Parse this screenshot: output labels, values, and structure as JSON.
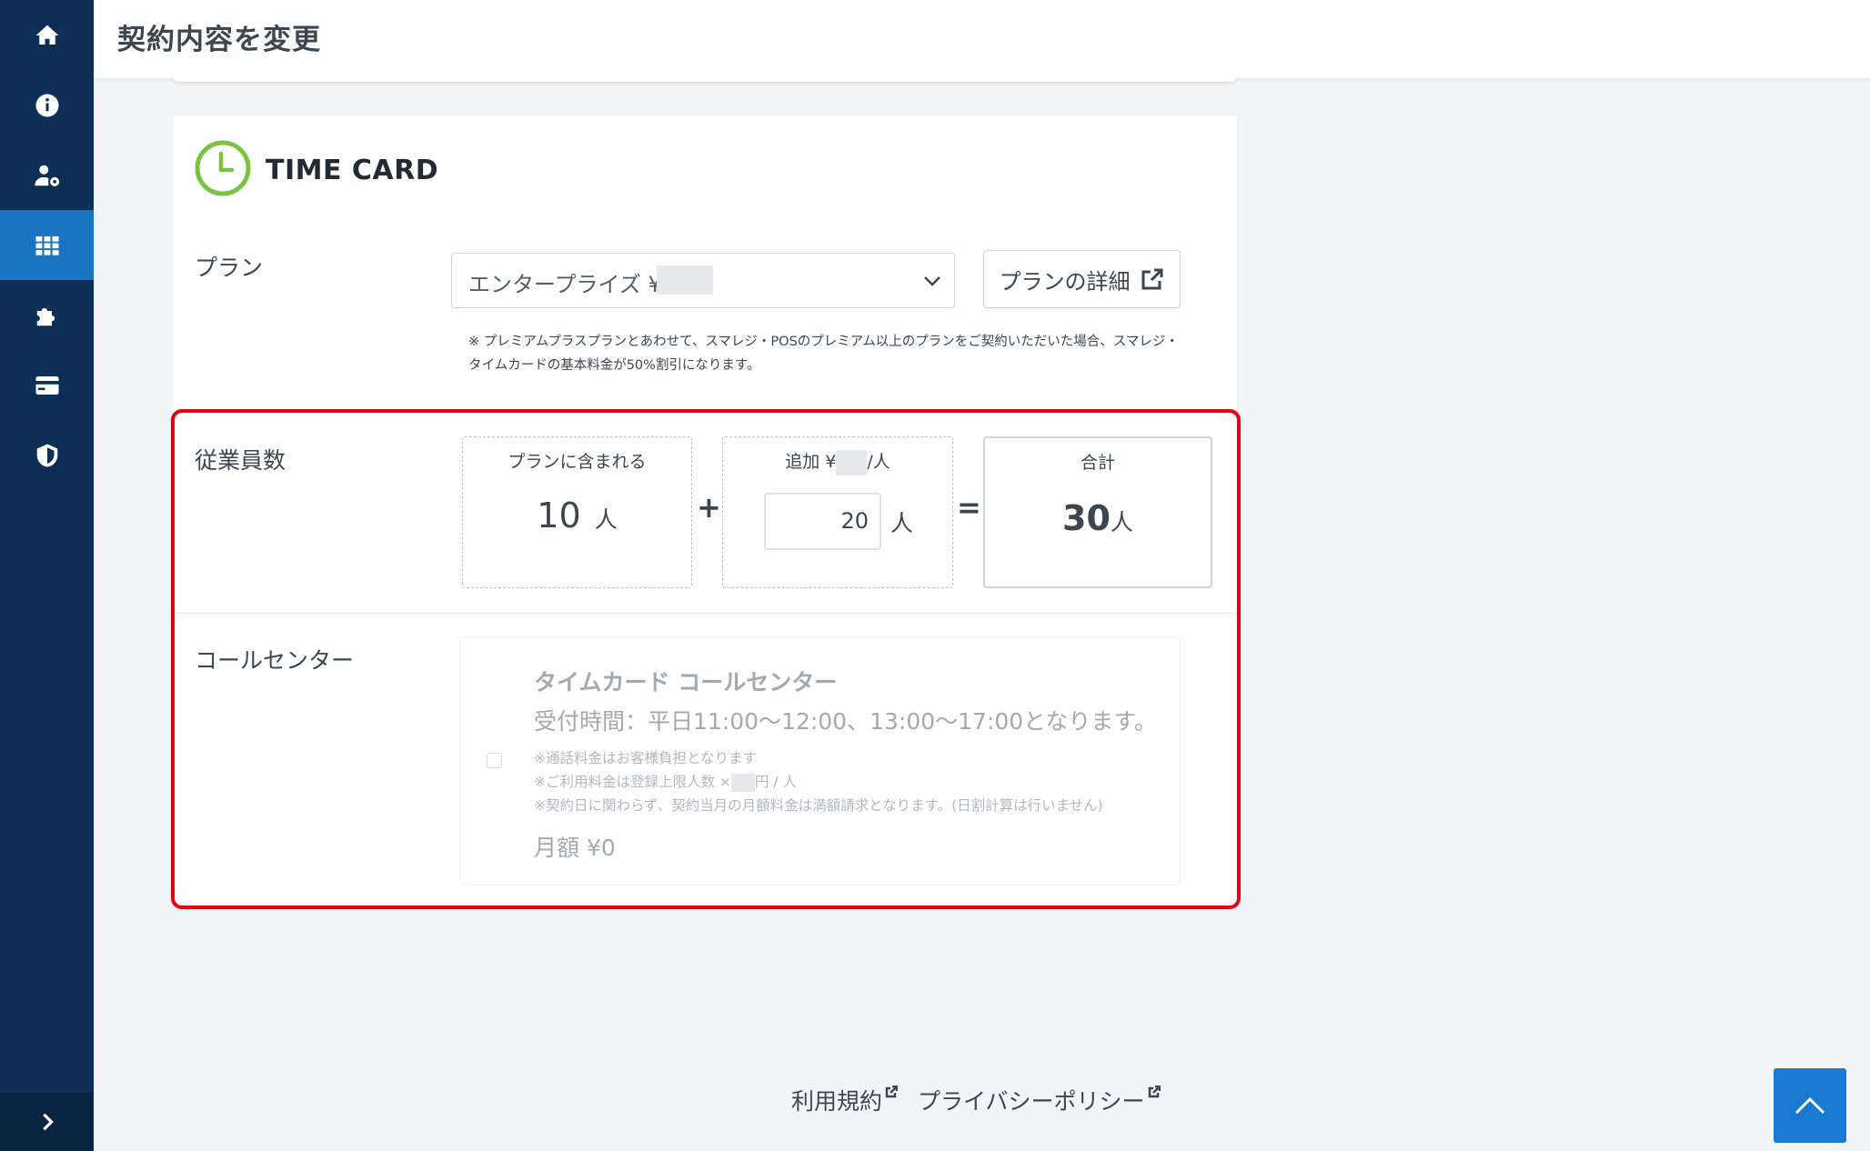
{
  "header": {
    "title": "契約内容を変更"
  },
  "sidebar": {
    "items": [
      {
        "icon": "home-icon",
        "active": false
      },
      {
        "icon": "info-icon",
        "active": false
      },
      {
        "icon": "user-settings-icon",
        "active": false
      },
      {
        "icon": "apps-grid-icon",
        "active": true
      },
      {
        "icon": "puzzle-icon",
        "active": false
      },
      {
        "icon": "credit-card-icon",
        "active": false
      },
      {
        "icon": "shield-icon",
        "active": false
      }
    ],
    "expand_icon": "chevron-right-icon"
  },
  "card": {
    "title": "TIME CARD",
    "plan": {
      "label": "プラン",
      "selected": "エンタープライズ ¥",
      "detail_button": "プランの詳細",
      "note_line1": "※ プレミアムプラスプランとあわせて、スマレジ・POSのプレミアム以上のプランをご契約いただいた場合、スマレジ・",
      "note_line2": "タイムカードの基本料金が50%割引になります。"
    },
    "employees": {
      "label": "従業員数",
      "included_title": "プランに含まれる",
      "included_value": "10",
      "unit": "人",
      "add_title_prefix": "追加 ¥",
      "add_title_suffix": "/人",
      "add_value": "20",
      "total_title": "合計",
      "total_value": "30",
      "plus": "+",
      "equals": "="
    },
    "call_center": {
      "label": "コールセンター",
      "title": "タイムカード コールセンター",
      "hours": "受付時間：平日11:00〜12:00、13:00〜17:00となります。",
      "note1": "※通話料金はお客様負担となります",
      "note2_prefix": "※ご利用料金は登録上限人数 ×",
      "note2_suffix": "円 / 人",
      "note3": "※契約日に関わらず、契約当月の月額料金は満額請求となります。(日割計算は行いません)",
      "price": "月額 ¥0",
      "checked": false
    }
  },
  "footer": {
    "terms": "利用規約",
    "privacy": "プライバシーポリシー"
  },
  "colors": {
    "sidebar": "#0e2f55",
    "sidebar_active": "#1a74c4",
    "highlight": "#e60012",
    "timecard_green": "#7cc242",
    "scroll_top": "#1a7ad2"
  }
}
